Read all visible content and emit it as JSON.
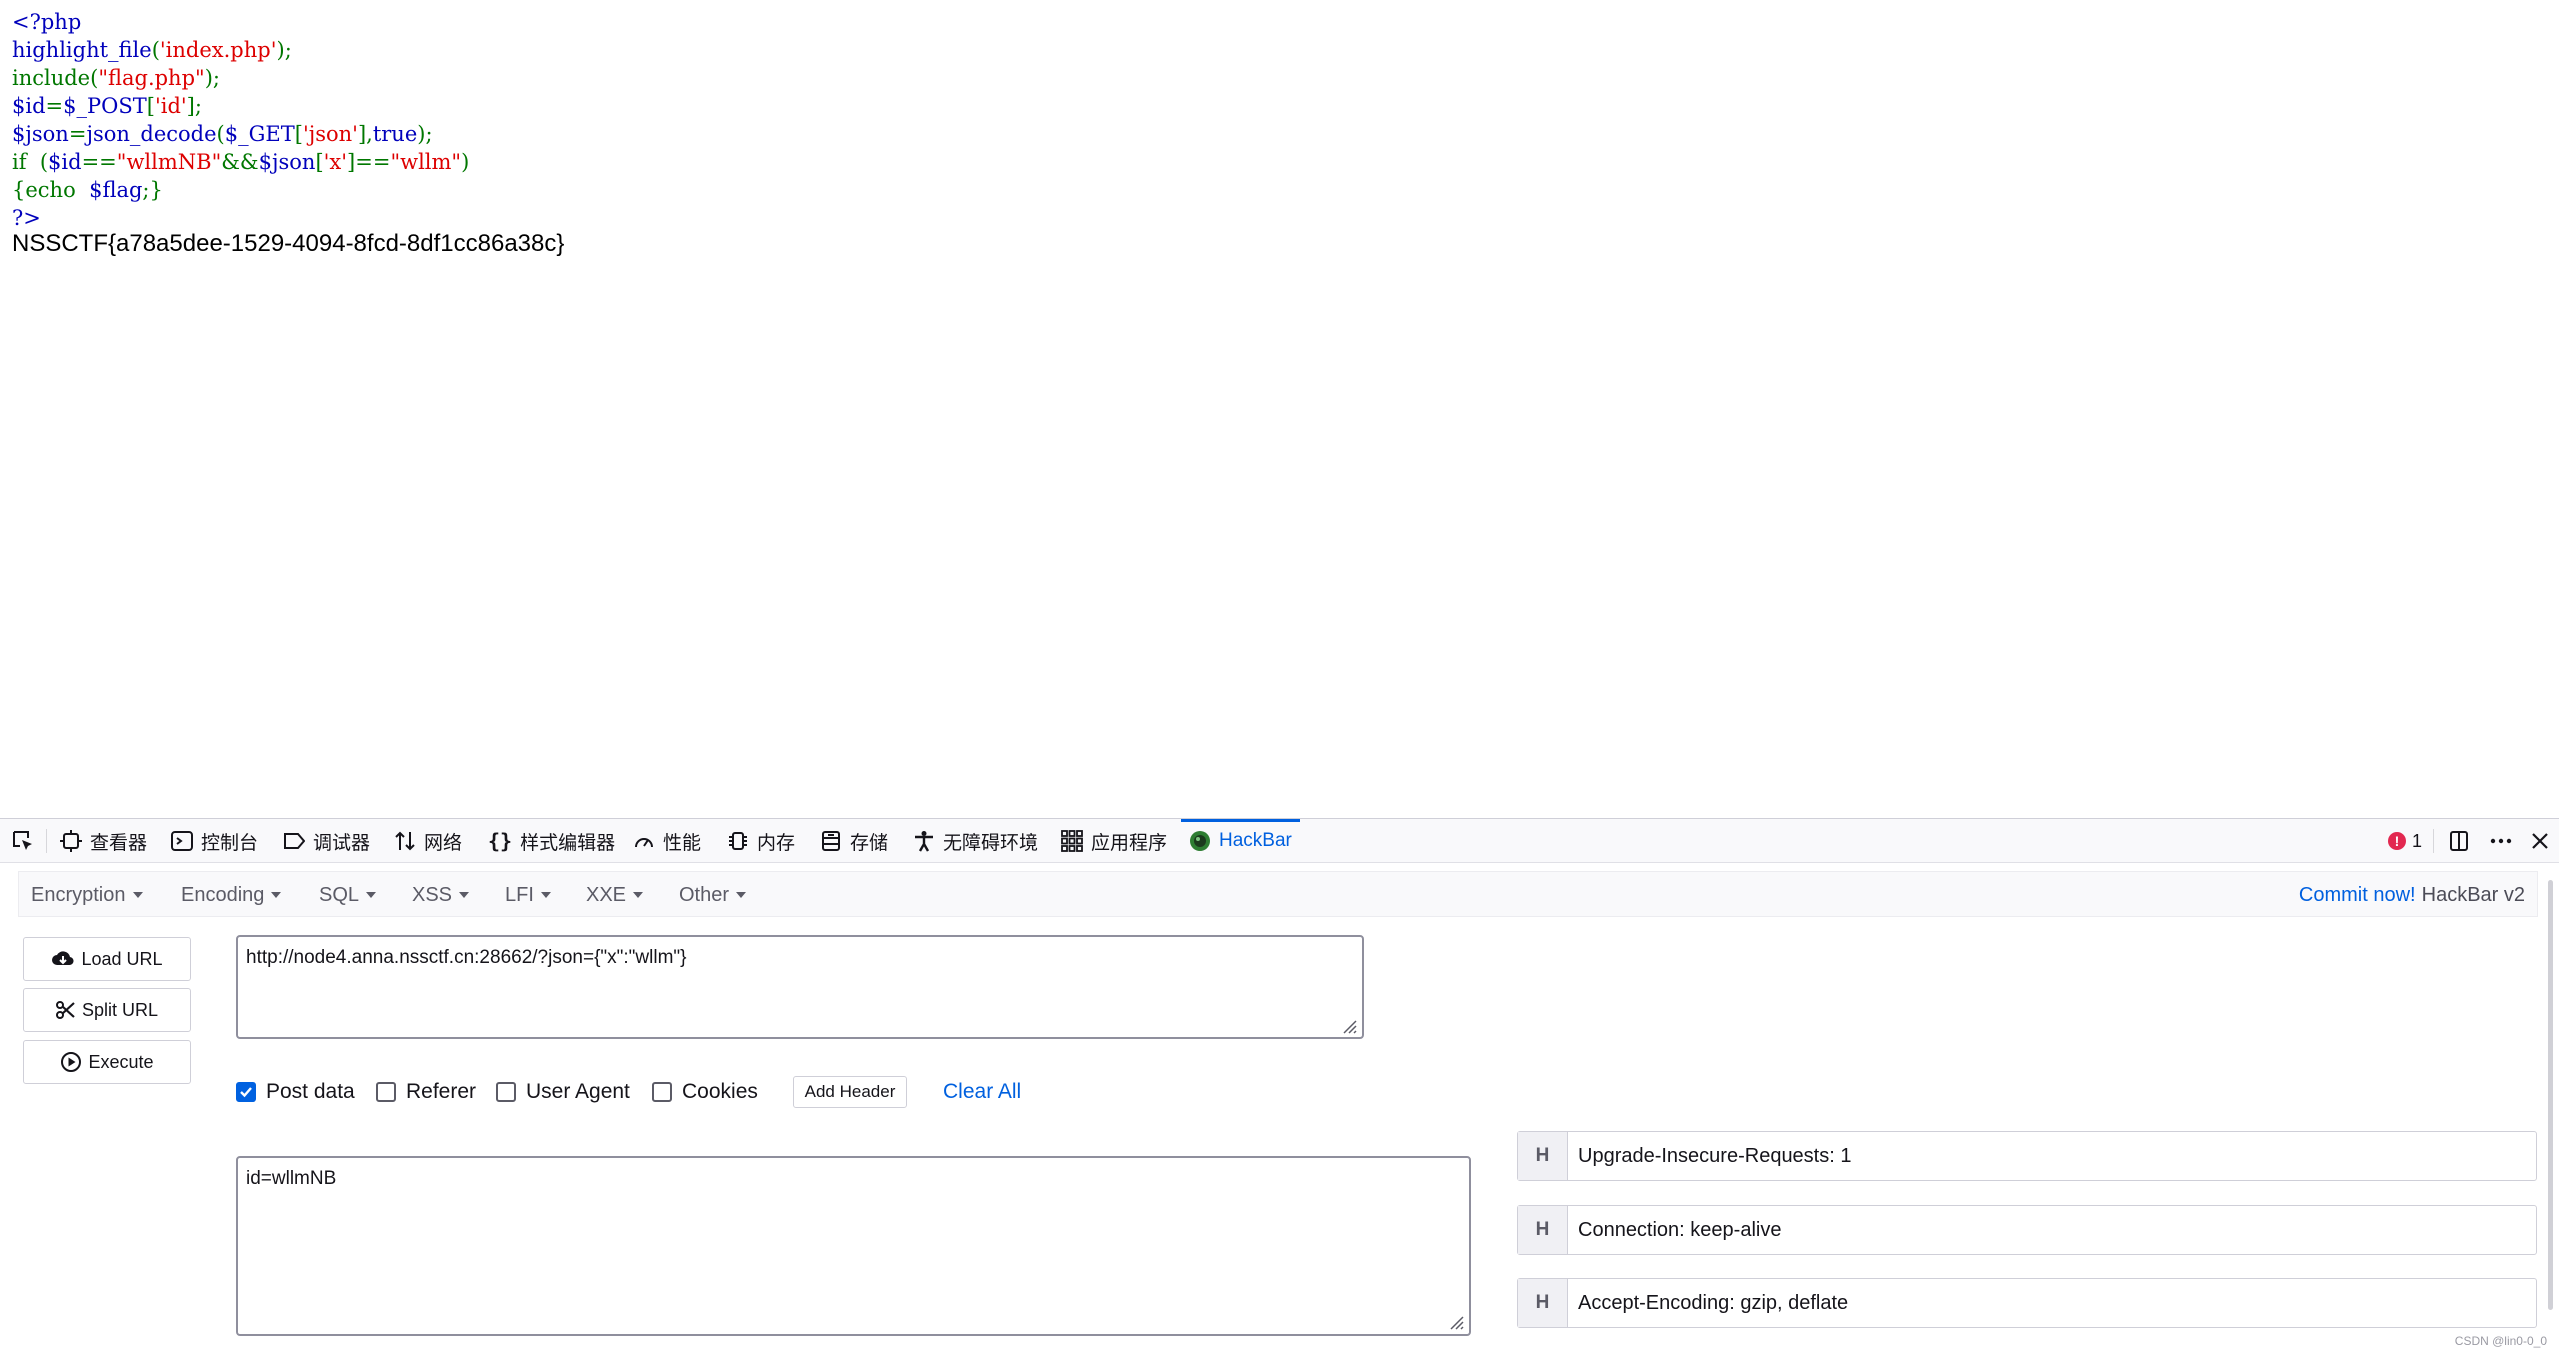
{
  "code": {
    "lines": [
      {
        "parts": [
          {
            "t": "<?php",
            "c": "def"
          }
        ]
      },
      {
        "parts": [
          {
            "t": "highlight_file",
            "c": "def"
          },
          {
            "t": "(",
            "c": "kw"
          },
          {
            "t": "'index.php'",
            "c": "str"
          },
          {
            "t": ");",
            "c": "kw"
          }
        ]
      },
      {
        "parts": [
          {
            "t": "include(",
            "c": "kw"
          },
          {
            "t": "\"flag.php\"",
            "c": "str"
          },
          {
            "t": ");",
            "c": "kw"
          }
        ]
      },
      {
        "parts": [
          {
            "t": "$id",
            "c": "def"
          },
          {
            "t": "=",
            "c": "kw"
          },
          {
            "t": "$_POST",
            "c": "def"
          },
          {
            "t": "[",
            "c": "kw"
          },
          {
            "t": "'id'",
            "c": "str"
          },
          {
            "t": "];",
            "c": "kw"
          }
        ]
      },
      {
        "parts": [
          {
            "t": "$json",
            "c": "def"
          },
          {
            "t": "=",
            "c": "kw"
          },
          {
            "t": "json_decode",
            "c": "def"
          },
          {
            "t": "(",
            "c": "kw"
          },
          {
            "t": "$_GET",
            "c": "def"
          },
          {
            "t": "[",
            "c": "kw"
          },
          {
            "t": "'json'",
            "c": "str"
          },
          {
            "t": "],",
            "c": "kw"
          },
          {
            "t": "true",
            "c": "def"
          },
          {
            "t": ");",
            "c": "kw"
          }
        ]
      },
      {
        "parts": [
          {
            "t": "if  ",
            "c": "kw"
          },
          {
            "t": "(",
            "c": "kw"
          },
          {
            "t": "$id",
            "c": "def"
          },
          {
            "t": "==",
            "c": "kw"
          },
          {
            "t": "\"wllmNB\"",
            "c": "str"
          },
          {
            "t": "&&",
            "c": "kw"
          },
          {
            "t": "$json",
            "c": "def"
          },
          {
            "t": "[",
            "c": "kw"
          },
          {
            "t": "'x'",
            "c": "str"
          },
          {
            "t": "]==",
            "c": "kw"
          },
          {
            "t": "\"wllm\"",
            "c": "str"
          },
          {
            "t": ")",
            "c": "kw"
          }
        ]
      },
      {
        "parts": [
          {
            "t": "{echo  ",
            "c": "kw"
          },
          {
            "t": "$flag",
            "c": "def"
          },
          {
            "t": ";}",
            "c": "kw"
          }
        ]
      },
      {
        "parts": [
          {
            "t": "?>",
            "c": "def"
          }
        ]
      }
    ],
    "flag_output": "NSSCTF{a78a5dee-1529-4094-8fcd-8df1cc86a38c}"
  },
  "devtools": {
    "tabs": [
      {
        "id": "inspector",
        "label": "查看器",
        "icon": "inspector-icon"
      },
      {
        "id": "console",
        "label": "控制台",
        "icon": "console-icon"
      },
      {
        "id": "debugger",
        "label": "调试器",
        "icon": "debugger-icon"
      },
      {
        "id": "network",
        "label": "网络",
        "icon": "network-icon"
      },
      {
        "id": "style-editor",
        "label": "样式编辑器",
        "icon": "braces-icon"
      },
      {
        "id": "performance",
        "label": "性能",
        "icon": "gauge-icon"
      },
      {
        "id": "memory",
        "label": "内存",
        "icon": "memory-chip-icon"
      },
      {
        "id": "storage",
        "label": "存储",
        "icon": "storage-icon"
      },
      {
        "id": "accessibility",
        "label": "无障碍环境",
        "icon": "accessibility-icon"
      },
      {
        "id": "application",
        "label": "应用程序",
        "icon": "grid-icon"
      },
      {
        "id": "hackbar",
        "label": "HackBar",
        "icon": "hackbar-logo-icon",
        "active": true
      }
    ],
    "error_count": "1",
    "accent_color": "#0060df"
  },
  "hackbar": {
    "menus": [
      "Encoding",
      "Encoding",
      "SQL",
      "XSS",
      "LFI",
      "XXE",
      "Other"
    ],
    "menu_labels": {
      "encryption": "Encryption",
      "encoding": "Encoding",
      "sql": "SQL",
      "xss": "XSS",
      "lfi": "LFI",
      "xxe": "XXE",
      "other": "Other"
    },
    "commit_link": "Commit now!",
    "commit_version": "HackBar v2",
    "buttons": {
      "load_url": "Load URL",
      "split_url": "Split URL",
      "execute": "Execute"
    },
    "url_value": "http://node4.anna.nssctf.cn:28662/?json={\"x\":\"wllm\"}",
    "options": {
      "post_data": {
        "label": "Post data",
        "checked": true
      },
      "referer": {
        "label": "Referer",
        "checked": false
      },
      "user_agent": {
        "label": "User Agent",
        "checked": false
      },
      "cookies": {
        "label": "Cookies",
        "checked": false
      }
    },
    "add_header_label": "Add Header",
    "clear_all_label": "Clear All",
    "post_body": "id=wllmNB",
    "headers": [
      {
        "key": "H",
        "value": "Upgrade-Insecure-Requests: 1"
      },
      {
        "key": "H",
        "value": "Connection: keep-alive"
      },
      {
        "key": "H",
        "value": "Accept-Encoding: gzip, deflate"
      }
    ]
  },
  "watermark": "CSDN @lin0-0_0"
}
